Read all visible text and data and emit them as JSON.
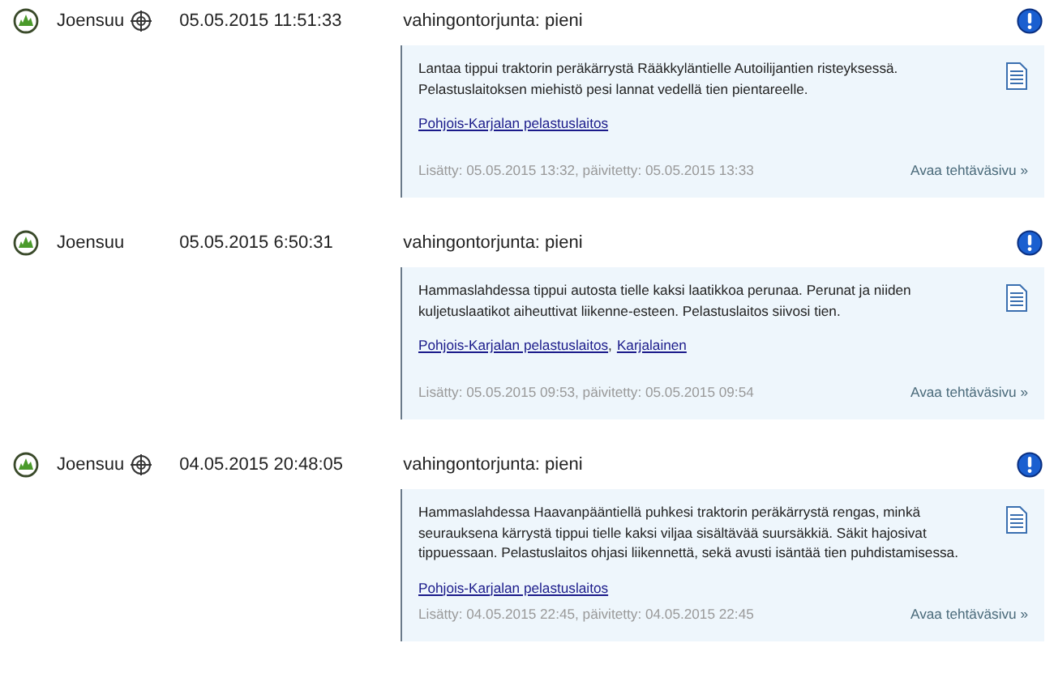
{
  "source_separator": ",",
  "events": [
    {
      "place": "Joensuu",
      "location_marker": true,
      "time": "05.05.2015 11:51:33",
      "title": "vahingontorjunta: pieni",
      "description": "Lantaa tippui traktorin peräkärrystä Rääkkyläntielle Autoilijantien risteyksessä. Pelastuslaitoksen miehistö pesi lannat vedellä tien pientareelle.",
      "sources": [
        "Pohjois-Karjalan pelastuslaitos"
      ],
      "meta": "Lisätty: 05.05.2015 13:32, päivitetty: 05.05.2015 13:33",
      "open_link": "Avaa tehtäväsivu »"
    },
    {
      "place": "Joensuu",
      "location_marker": false,
      "time": "05.05.2015 6:50:31",
      "title": "vahingontorjunta: pieni",
      "description": "Hammaslahdessa tippui autosta tielle kaksi laatikkoa perunaa. Perunat ja niiden kuljetuslaatikot aiheuttivat liikenne-esteen. Pelastuslaitos siivosi tien.",
      "sources": [
        "Pohjois-Karjalan pelastuslaitos",
        "Karjalainen"
      ],
      "meta": "Lisätty: 05.05.2015 09:53, päivitetty: 05.05.2015 09:54",
      "open_link": "Avaa tehtäväsivu »"
    },
    {
      "place": "Joensuu",
      "location_marker": true,
      "time": "04.05.2015 20:48:05",
      "title": "vahingontorjunta: pieni",
      "description": "Hammaslahdessa Haavanpääntiellä puhkesi traktorin peräkärrystä rengas, minkä seurauksena kärrystä tippui tielle kaksi viljaa sisältävää suursäkkiä. Säkit hajosivat tippuessaan. Pelastuslaitos ohjasi liikennettä, sekä avusti isäntää tien puhdistamisessa.",
      "sources": [
        "Pohjois-Karjalan pelastuslaitos"
      ],
      "meta": "Lisätty: 04.05.2015 22:45, päivitetty: 04.05.2015 22:45",
      "open_link": "Avaa tehtäväsivu »"
    }
  ]
}
